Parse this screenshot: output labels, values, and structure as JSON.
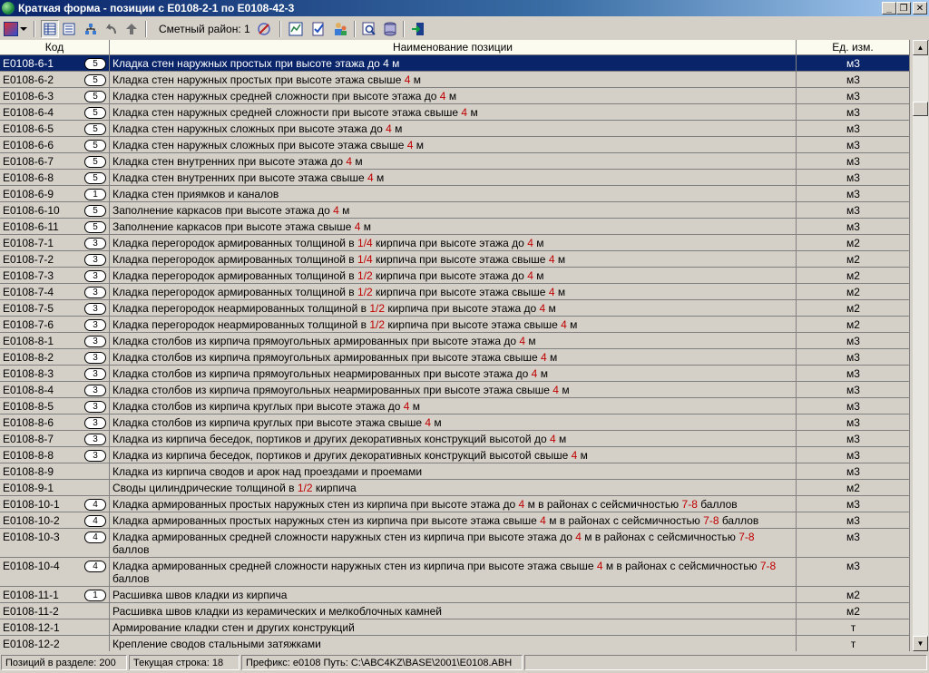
{
  "window": {
    "title": "Краткая форма - позиции с Е0108-2-1 по Е0108-42-3",
    "minimize": "_",
    "maximize": "❐",
    "close": "✕"
  },
  "toolbar": {
    "region_label": "Сметный район: 1",
    "icons": [
      "app-logo-icon",
      "dropdown-arrow-icon",
      "view-table-icon",
      "view-list-icon",
      "tree-view-icon",
      "undo-arrow-icon",
      "up-arrow-icon",
      "pen-edit-icon",
      "chart-check-icon",
      "check-document-icon",
      "people-icon",
      "search-icon",
      "database-icon",
      "exit-door-icon"
    ]
  },
  "columns": [
    "Код",
    "Наименование позиции",
    "Ед. изм."
  ],
  "rows": [
    {
      "code": "Е0108-6-1",
      "badge": "5",
      "name": [
        [
          "Кладка стен наружных простых при высоте этажа до ",
          ""
        ],
        [
          "4",
          "hl"
        ],
        [
          " м",
          ""
        ]
      ],
      "unit": "м3",
      "selected": true
    },
    {
      "code": "Е0108-6-2",
      "badge": "5",
      "name": [
        [
          "Кладка стен наружных простых при высоте этажа свыше ",
          ""
        ],
        [
          "4",
          "hl"
        ],
        [
          " м",
          ""
        ]
      ],
      "unit": "м3"
    },
    {
      "code": "Е0108-6-3",
      "badge": "5",
      "name": [
        [
          "Кладка стен наружных средней сложности при высоте этажа до ",
          ""
        ],
        [
          "4",
          "hl"
        ],
        [
          " м",
          ""
        ]
      ],
      "unit": "м3"
    },
    {
      "code": "Е0108-6-4",
      "badge": "5",
      "name": [
        [
          "Кладка стен наружных средней сложности при высоте этажа свыше ",
          ""
        ],
        [
          "4",
          "hl"
        ],
        [
          " м",
          ""
        ]
      ],
      "unit": "м3"
    },
    {
      "code": "Е0108-6-5",
      "badge": "5",
      "name": [
        [
          "Кладка стен наружных сложных при высоте этажа до ",
          ""
        ],
        [
          "4",
          "hl"
        ],
        [
          " м",
          ""
        ]
      ],
      "unit": "м3"
    },
    {
      "code": "Е0108-6-6",
      "badge": "5",
      "name": [
        [
          "Кладка стен наружных сложных при высоте этажа свыше ",
          ""
        ],
        [
          "4",
          "hl"
        ],
        [
          " м",
          ""
        ]
      ],
      "unit": "м3"
    },
    {
      "code": "Е0108-6-7",
      "badge": "5",
      "name": [
        [
          "Кладка стен внутренних при высоте этажа до ",
          ""
        ],
        [
          "4",
          "hl"
        ],
        [
          " м",
          ""
        ]
      ],
      "unit": "м3"
    },
    {
      "code": "Е0108-6-8",
      "badge": "5",
      "name": [
        [
          "Кладка стен внутренних при высоте этажа свыше ",
          ""
        ],
        [
          "4",
          "hl"
        ],
        [
          " м",
          ""
        ]
      ],
      "unit": "м3"
    },
    {
      "code": "Е0108-6-9",
      "badge": "1",
      "name": [
        [
          "Кладка стен приямков и каналов",
          ""
        ]
      ],
      "unit": "м3"
    },
    {
      "code": "Е0108-6-10",
      "badge": "5",
      "name": [
        [
          "Заполнение каркасов при высоте этажа до ",
          ""
        ],
        [
          "4",
          "hl"
        ],
        [
          " м",
          ""
        ]
      ],
      "unit": "м3"
    },
    {
      "code": "Е0108-6-11",
      "badge": "5",
      "name": [
        [
          "Заполнение каркасов при высоте этажа свыше ",
          ""
        ],
        [
          "4",
          "hl"
        ],
        [
          " м",
          ""
        ]
      ],
      "unit": "м3"
    },
    {
      "code": "Е0108-7-1",
      "badge": "3",
      "name": [
        [
          "Кладка перегородок армированных толщиной в ",
          ""
        ],
        [
          "1/4",
          "hl"
        ],
        [
          " кирпича при высоте этажа до ",
          ""
        ],
        [
          "4",
          "hl"
        ],
        [
          " м",
          ""
        ]
      ],
      "unit": "м2"
    },
    {
      "code": "Е0108-7-2",
      "badge": "3",
      "name": [
        [
          "Кладка перегородок армированных толщиной в ",
          ""
        ],
        [
          "1/4",
          "hl"
        ],
        [
          " кирпича при высоте этажа свыше ",
          ""
        ],
        [
          "4",
          "hl"
        ],
        [
          " м",
          ""
        ]
      ],
      "unit": "м2"
    },
    {
      "code": "Е0108-7-3",
      "badge": "3",
      "name": [
        [
          "Кладка перегородок армированных толщиной в ",
          ""
        ],
        [
          "1/2",
          "hl"
        ],
        [
          " кирпича при высоте этажа до ",
          ""
        ],
        [
          "4",
          "hl"
        ],
        [
          " м",
          ""
        ]
      ],
      "unit": "м2"
    },
    {
      "code": "Е0108-7-4",
      "badge": "3",
      "name": [
        [
          "Кладка перегородок армированных толщиной в ",
          ""
        ],
        [
          "1/2",
          "hl"
        ],
        [
          " кирпича при высоте этажа свыше ",
          ""
        ],
        [
          "4",
          "hl"
        ],
        [
          " м",
          ""
        ]
      ],
      "unit": "м2"
    },
    {
      "code": "Е0108-7-5",
      "badge": "3",
      "name": [
        [
          "Кладка перегородок неармированных толщиной в ",
          ""
        ],
        [
          "1/2",
          "hl"
        ],
        [
          " кирпича при высоте этажа до ",
          ""
        ],
        [
          "4",
          "hl"
        ],
        [
          " м",
          ""
        ]
      ],
      "unit": "м2"
    },
    {
      "code": "Е0108-7-6",
      "badge": "3",
      "name": [
        [
          "Кладка перегородок неармированных толщиной в ",
          ""
        ],
        [
          "1/2",
          "hl"
        ],
        [
          " кирпича при высоте этажа свыше ",
          ""
        ],
        [
          "4",
          "hl"
        ],
        [
          " м",
          ""
        ]
      ],
      "unit": "м2"
    },
    {
      "code": "Е0108-8-1",
      "badge": "3",
      "name": [
        [
          "Кладка столбов из кирпича прямоугольных армированных при высоте этажа до ",
          ""
        ],
        [
          "4",
          "hl"
        ],
        [
          " м",
          ""
        ]
      ],
      "unit": "м3"
    },
    {
      "code": "Е0108-8-2",
      "badge": "3",
      "name": [
        [
          "Кладка столбов из кирпича прямоугольных армированных при высоте этажа свыше ",
          ""
        ],
        [
          "4",
          "hl"
        ],
        [
          " м",
          ""
        ]
      ],
      "unit": "м3"
    },
    {
      "code": "Е0108-8-3",
      "badge": "3",
      "name": [
        [
          "Кладка столбов из кирпича прямоугольных неармированных при высоте этажа до ",
          ""
        ],
        [
          "4",
          "hl"
        ],
        [
          " м",
          ""
        ]
      ],
      "unit": "м3"
    },
    {
      "code": "Е0108-8-4",
      "badge": "3",
      "name": [
        [
          "Кладка столбов из кирпича прямоугольных неармированных при высоте этажа свыше ",
          ""
        ],
        [
          "4",
          "hl"
        ],
        [
          " м",
          ""
        ]
      ],
      "unit": "м3"
    },
    {
      "code": "Е0108-8-5",
      "badge": "3",
      "name": [
        [
          "Кладка столбов из кирпича круглых при высоте этажа до ",
          ""
        ],
        [
          "4",
          "hl"
        ],
        [
          " м",
          ""
        ]
      ],
      "unit": "м3"
    },
    {
      "code": "Е0108-8-6",
      "badge": "3",
      "name": [
        [
          "Кладка столбов из кирпича круглых при высоте этажа свыше ",
          ""
        ],
        [
          "4",
          "hl"
        ],
        [
          " м",
          ""
        ]
      ],
      "unit": "м3"
    },
    {
      "code": "Е0108-8-7",
      "badge": "3",
      "name": [
        [
          "Кладка из кирпича беседок, портиков и других декоративных конструкций высотой до ",
          ""
        ],
        [
          "4",
          "hl"
        ],
        [
          " м",
          ""
        ]
      ],
      "unit": "м3"
    },
    {
      "code": "Е0108-8-8",
      "badge": "3",
      "name": [
        [
          "Кладка из кирпича беседок, портиков и других декоративных конструкций высотой свыше ",
          ""
        ],
        [
          "4",
          "hl"
        ],
        [
          " м",
          ""
        ]
      ],
      "unit": "м3"
    },
    {
      "code": "Е0108-8-9",
      "badge": "",
      "name": [
        [
          "Кладка из кирпича сводов и арок над проездами и проемами",
          ""
        ]
      ],
      "unit": "м3"
    },
    {
      "code": "Е0108-9-1",
      "badge": "",
      "name": [
        [
          "Своды цилиндрические толщиной в ",
          ""
        ],
        [
          "1/2",
          "hl"
        ],
        [
          " кирпича",
          ""
        ]
      ],
      "unit": "м2"
    },
    {
      "code": "Е0108-10-1",
      "badge": "4",
      "name": [
        [
          "Кладка армированных простых наружных стен из кирпича при высоте этажа до ",
          ""
        ],
        [
          "4",
          "hl"
        ],
        [
          " м в районах с сейсмичностью ",
          ""
        ],
        [
          "7-8",
          "hl"
        ],
        [
          " баллов",
          ""
        ]
      ],
      "unit": "м3"
    },
    {
      "code": "Е0108-10-2",
      "badge": "4",
      "name": [
        [
          "Кладка армированных простых наружных стен из кирпича при высоте этажа свыше ",
          ""
        ],
        [
          "4",
          "hl"
        ],
        [
          " м в районах с сейсмичностью ",
          ""
        ],
        [
          "7-8",
          "hl"
        ],
        [
          " баллов",
          ""
        ]
      ],
      "unit": "м3"
    },
    {
      "code": "Е0108-10-3",
      "badge": "4",
      "tall": true,
      "name": [
        [
          "Кладка армированных средней сложности наружных стен из кирпича при высоте этажа до ",
          ""
        ],
        [
          "4",
          "hl"
        ],
        [
          " м в районах с сейсмичностью ",
          ""
        ],
        [
          "7-8",
          "hl"
        ],
        [
          " баллов",
          ""
        ]
      ],
      "unit": "м3"
    },
    {
      "code": "Е0108-10-4",
      "badge": "4",
      "tall": true,
      "name": [
        [
          "Кладка армированных средней сложности наружных стен из кирпича при высоте этажа свыше ",
          ""
        ],
        [
          "4",
          "hl"
        ],
        [
          " м в районах с сейсмичностью ",
          ""
        ],
        [
          "7-8",
          "hl"
        ],
        [
          " баллов",
          ""
        ]
      ],
      "unit": "м3"
    },
    {
      "code": "Е0108-11-1",
      "badge": "1",
      "name": [
        [
          "Расшивка швов кладки из кирпича",
          ""
        ]
      ],
      "unit": "м2"
    },
    {
      "code": "Е0108-11-2",
      "badge": "",
      "name": [
        [
          "Расшивка швов кладки из керамических и мелкоблочных камней",
          ""
        ]
      ],
      "unit": "м2"
    },
    {
      "code": "Е0108-12-1",
      "badge": "",
      "name": [
        [
          "Армирование кладки стен и других конструкций",
          ""
        ]
      ],
      "unit": "т"
    },
    {
      "code": "Е0108-12-2",
      "badge": "",
      "name": [
        [
          "Крепление сводов стальными затяжками",
          ""
        ]
      ],
      "unit": "т"
    }
  ],
  "status": {
    "count": "Позиций в разделе: 200",
    "current": "Текущая строка: 18",
    "prefix": "Префикс: е0108 Путь: C:\\ABC4KZ\\BASE\\2001\\E0108.ABH"
  },
  "colors": {
    "selection": "#0a246a",
    "highlight_number": "#c00000",
    "window_face": "#d4d0c8"
  }
}
